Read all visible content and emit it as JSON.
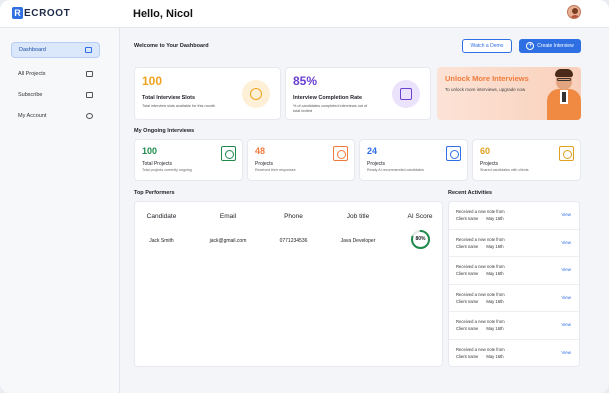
{
  "app": {
    "logo_letter": "R",
    "logo_text": "ECROOT",
    "greeting": "Hello, Nicol"
  },
  "sidebar": {
    "items": [
      {
        "label": "Dashboard",
        "icon": "dashboard-icon",
        "active": true
      },
      {
        "label": "All Projects",
        "icon": "projects-icon",
        "active": false
      },
      {
        "label": "Subscribe",
        "icon": "subscribe-icon",
        "active": false
      },
      {
        "label": "My Account",
        "icon": "account-icon",
        "active": false
      }
    ]
  },
  "header": {
    "welcome": "Welcome to Your Dashboard",
    "watch_demo": "Watch a Demo",
    "create_interview": "Create Interview"
  },
  "stats": [
    {
      "value": "100",
      "label": "Total Interview Slots",
      "sub": "Total interview slots available for this month",
      "color": "#f0a21e",
      "icon": "sun-icon"
    },
    {
      "value": "85%",
      "label": "Interview Completion Rate",
      "sub": "% of candidates completed interviews out of total invited",
      "color": "#6a3fd1",
      "icon": "report-icon"
    }
  ],
  "promo": {
    "title": "Unlock More Interviews",
    "sub": "To unlock more interviews, upgrade now"
  },
  "ongoing": {
    "title": "My Ongoing Interviews",
    "cards": [
      {
        "value": "100",
        "label": "Total Projects",
        "sub": "Total projects currently ongoing",
        "color": "#1f8a4c",
        "icon": "org-chart-icon"
      },
      {
        "value": "48",
        "label": "Projects",
        "sub": "Received their responses",
        "color": "#f07a3b",
        "icon": "people-icon"
      },
      {
        "value": "24",
        "label": "Projects",
        "sub": "Ready AI recommended candidates",
        "color": "#2f6fe4",
        "icon": "team-icon"
      },
      {
        "value": "60",
        "label": "Projects",
        "sub": "Shared candidates with clients",
        "color": "#e0a020",
        "icon": "group-icon"
      }
    ]
  },
  "performers": {
    "title": "Top Performers",
    "columns": [
      "Candidate",
      "Email",
      "Phone",
      "Job title",
      "AI Score"
    ],
    "rows": [
      {
        "candidate": "Jack Smith",
        "email": "jack@gmail.com",
        "phone": "0771234536",
        "job": "Java Developer",
        "score": "80%",
        "score_value": 0.8
      }
    ]
  },
  "activities": {
    "title": "Recent Activities",
    "items": [
      {
        "title": "Received a new note from",
        "client": "Client name",
        "date": "May 16th",
        "action": "View"
      },
      {
        "title": "Received a new note from",
        "client": "Client name",
        "date": "May 16th",
        "action": "View"
      },
      {
        "title": "Received a new note from",
        "client": "Client name",
        "date": "May 16th",
        "action": "View"
      },
      {
        "title": "Received a new note from",
        "client": "Client name",
        "date": "May 16th",
        "action": "View"
      },
      {
        "title": "Received a new note from",
        "client": "Client name",
        "date": "May 16th",
        "action": "View"
      },
      {
        "title": "Received a new note from",
        "client": "Client name",
        "date": "May 16th",
        "action": "View"
      }
    ]
  },
  "colors": {
    "accent": "#2f6fe4",
    "score_ring": "#1f8a4c"
  }
}
